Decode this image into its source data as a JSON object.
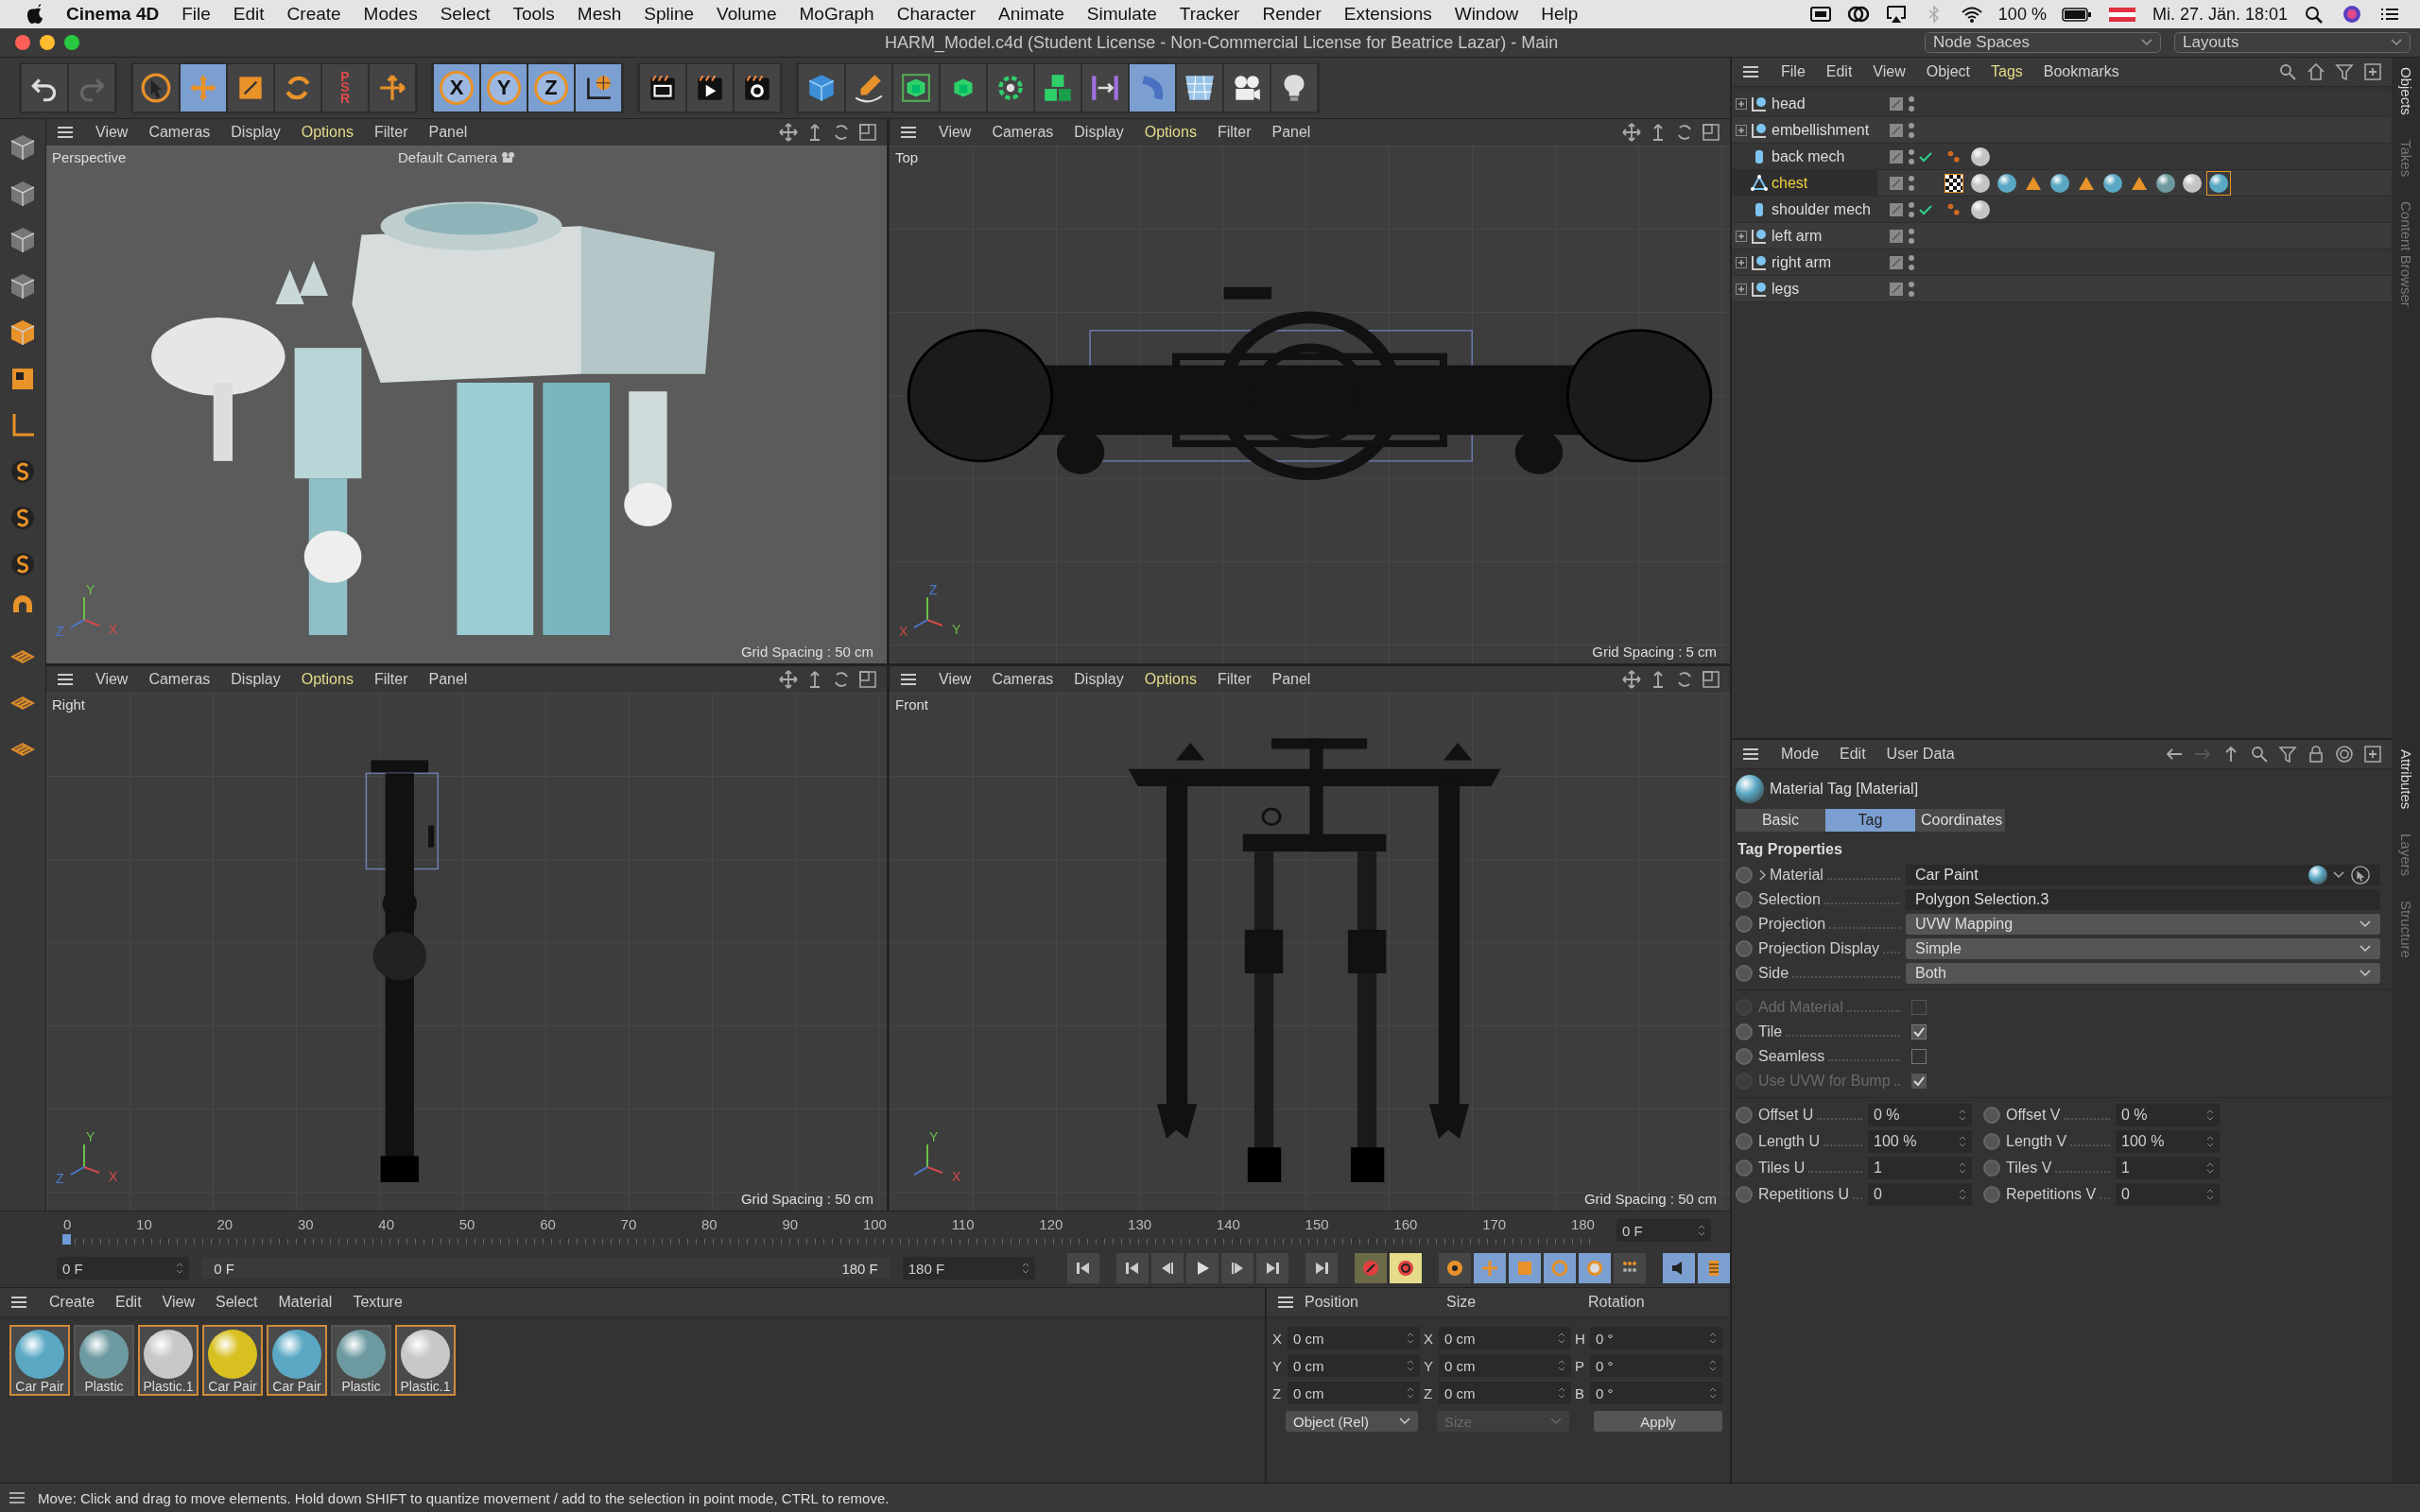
{
  "menubar": {
    "app": "Cinema 4D",
    "items": [
      "File",
      "Edit",
      "Create",
      "Modes",
      "Select",
      "Tools",
      "Mesh",
      "Spline",
      "Volume",
      "MoGraph",
      "Character",
      "Animate",
      "Simulate",
      "Tracker",
      "Render",
      "Extensions",
      "Window",
      "Help"
    ],
    "battery": "100 %",
    "clock": "Mi. 27. Jän. 18:01"
  },
  "window": {
    "title": "HARM_Model.c4d (Student License - Non-Commercial License for Beatrice Lazar) - Main",
    "dropdowns": [
      "Node Spaces",
      "Layouts"
    ]
  },
  "toolbar": [
    [
      {
        "kind": "undo",
        "selected": false
      },
      {
        "kind": "redo",
        "selected": false
      }
    ],
    [
      {
        "kind": "select",
        "selected": false
      },
      {
        "kind": "move",
        "selected": true
      },
      {
        "kind": "scale",
        "selected": false
      },
      {
        "kind": "rotate",
        "selected": false
      },
      {
        "kind": "psr",
        "label": "PSR",
        "selected": false
      },
      {
        "kind": "axis",
        "selected": false
      }
    ],
    [
      {
        "kind": "letter",
        "label": "X",
        "selected": true
      },
      {
        "kind": "letter",
        "label": "Y",
        "selected": true
      },
      {
        "kind": "letter",
        "label": "Z",
        "selected": true
      },
      {
        "kind": "world",
        "selected": true
      }
    ],
    [
      {
        "kind": "clapper",
        "selected": false
      },
      {
        "kind": "render",
        "selected": false
      },
      {
        "kind": "render-settings",
        "selected": false
      }
    ],
    [
      {
        "kind": "cube",
        "selected": false
      },
      {
        "kind": "pen",
        "selected": false
      },
      {
        "kind": "subdiv",
        "selected": false
      },
      {
        "kind": "extrude",
        "selected": false
      },
      {
        "kind": "cloner",
        "selected": false
      },
      {
        "kind": "cubes",
        "selected": false
      },
      {
        "kind": "symmetry",
        "selected": false
      },
      {
        "kind": "deformer",
        "selected": true
      },
      {
        "kind": "floor",
        "selected": false
      },
      {
        "kind": "camera",
        "selected": false
      },
      {
        "kind": "light",
        "selected": false
      }
    ]
  ],
  "viewports": [
    {
      "kind": "perspective",
      "name": "Perspective",
      "camera": "Default Camera",
      "grid": "Grid Spacing : 50 cm",
      "menu": [
        {
          "label": "View",
          "selected": false
        },
        {
          "label": "Cameras",
          "selected": false
        },
        {
          "label": "Display",
          "selected": false
        },
        {
          "label": "Options",
          "selected": true
        },
        {
          "label": "Filter",
          "selected": false
        },
        {
          "label": "Panel",
          "selected": false
        }
      ],
      "axes": [
        {
          "label": "Y",
          "color": "#6cc04a"
        },
        {
          "label": "X",
          "color": "#d04a4a"
        },
        {
          "label": "Z",
          "color": "#4a7ad0"
        }
      ]
    },
    {
      "kind": "top",
      "name": "Top",
      "grid": "Grid Spacing : 5 cm",
      "menu": [
        {
          "label": "View",
          "selected": false
        },
        {
          "label": "Cameras",
          "selected": false
        },
        {
          "label": "Display",
          "selected": false
        },
        {
          "label": "Options",
          "selected": true
        },
        {
          "label": "Filter",
          "selected": false
        },
        {
          "label": "Panel",
          "selected": false
        }
      ],
      "axes": [
        {
          "label": "Z",
          "color": "#4a7ad0"
        },
        {
          "label": "Y",
          "color": "#6cc04a"
        },
        {
          "label": "X",
          "color": "#d04a4a"
        }
      ]
    },
    {
      "kind": "right",
      "name": "Right",
      "grid": "Grid Spacing : 50 cm",
      "menu": [
        {
          "label": "View",
          "selected": false
        },
        {
          "label": "Cameras",
          "selected": false
        },
        {
          "label": "Display",
          "selected": false
        },
        {
          "label": "Options",
          "selected": true
        },
        {
          "label": "Filter",
          "selected": false
        },
        {
          "label": "Panel",
          "selected": false
        }
      ],
      "axes": [
        {
          "label": "Y",
          "color": "#6cc04a"
        },
        {
          "label": "X",
          "color": "#d04a4a"
        },
        {
          "label": "Z",
          "color": "#4a7ad0"
        }
      ]
    },
    {
      "kind": "front",
      "name": "Front",
      "grid": "Grid Spacing : 50 cm",
      "menu": [
        {
          "label": "View",
          "selected": false
        },
        {
          "label": "Cameras",
          "selected": false
        },
        {
          "label": "Display",
          "selected": false
        },
        {
          "label": "Options",
          "selected": true
        },
        {
          "label": "Filter",
          "selected": false
        },
        {
          "label": "Panel",
          "selected": false
        }
      ],
      "axes": [
        {
          "label": "Y",
          "color": "#6cc04a"
        },
        {
          "label": "X",
          "color": "#d04a4a"
        }
      ]
    }
  ],
  "objects": {
    "menu": [
      {
        "label": "File",
        "selected": false
      },
      {
        "label": "Edit",
        "selected": false
      },
      {
        "label": "View",
        "selected": false
      },
      {
        "label": "Object",
        "selected": false
      },
      {
        "label": "Tags",
        "selected": true
      },
      {
        "label": "Bookmarks",
        "selected": false
      }
    ],
    "side_tabs": [
      {
        "label": "Objects",
        "selected": true
      },
      {
        "label": "Takes",
        "selected": false
      },
      {
        "label": "Content Browser",
        "selected": false
      }
    ],
    "items": [
      {
        "name": "head",
        "kind": "group",
        "expanded": false,
        "selected": false,
        "checked": false
      },
      {
        "name": "embellishment",
        "kind": "group",
        "expanded": false,
        "selected": false,
        "checked": false
      },
      {
        "name": "back mech",
        "kind": "cylinder",
        "selected": false,
        "checked": true,
        "tags": [
          {
            "kind": "points",
            "selected": false
          },
          {
            "kind": "material",
            "color": "#c4c4c4",
            "selected": false
          }
        ]
      },
      {
        "name": "chest",
        "kind": "polygon",
        "selected": true,
        "checked": false,
        "tags": [
          {
            "kind": "checker",
            "selected": false
          },
          {
            "kind": "material",
            "color": "#c4c4c4",
            "selected": false
          },
          {
            "kind": "material",
            "color": "#5aa8c4",
            "selected": false
          },
          {
            "kind": "triangle",
            "selected": false
          },
          {
            "kind": "material",
            "color": "#5aa8c4",
            "selected": false
          },
          {
            "kind": "triangle",
            "selected": false
          },
          {
            "kind": "material",
            "color": "#5aa8c4",
            "selected": false
          },
          {
            "kind": "triangle",
            "selected": false
          },
          {
            "kind": "material",
            "color": "#6d9aa0",
            "selected": false
          },
          {
            "kind": "material",
            "color": "#c4c4c4",
            "selected": false
          },
          {
            "kind": "material",
            "color": "#5aa8c4",
            "selected": true
          }
        ]
      },
      {
        "name": "shoulder mech",
        "kind": "cylinder",
        "selected": false,
        "checked": true,
        "tags": [
          {
            "kind": "points",
            "selected": false
          },
          {
            "kind": "material",
            "color": "#c4c4c4",
            "selected": false
          }
        ]
      },
      {
        "name": "left arm",
        "kind": "group",
        "expanded": false,
        "selected": false,
        "checked": false
      },
      {
        "name": "right arm",
        "kind": "group",
        "expanded": false,
        "selected": false,
        "checked": false
      },
      {
        "name": "legs",
        "kind": "group",
        "expanded": false,
        "selected": false,
        "checked": false
      }
    ]
  },
  "attributes": {
    "menu": [
      "Mode",
      "Edit",
      "User Data"
    ],
    "side_tabs": [
      {
        "label": "Attributes",
        "selected": true
      },
      {
        "label": "Layers",
        "selected": false
      },
      {
        "label": "Structure",
        "selected": false
      }
    ],
    "title": "Material Tag [Material]",
    "tabs": [
      {
        "label": "Basic",
        "selected": false
      },
      {
        "label": "Tag",
        "selected": true
      },
      {
        "label": "Coordinates",
        "selected": false
      }
    ],
    "section": "Tag Properties",
    "props": [
      {
        "kind": "link",
        "label": "Material",
        "value": "Car Paint"
      },
      {
        "kind": "text",
        "label": "Selection",
        "value": "Polygon Selection.3"
      },
      {
        "kind": "dropdown",
        "label": "Projection",
        "value": "UVW Mapping"
      },
      {
        "kind": "dropdown",
        "label": "Projection Display",
        "value": "Simple"
      },
      {
        "kind": "dropdown",
        "label": "Side",
        "value": "Both"
      }
    ],
    "checks": [
      {
        "label": "Add Material",
        "checked": false,
        "disabled": true
      },
      {
        "label": "Tile",
        "checked": true,
        "disabled": false
      },
      {
        "label": "Seamless",
        "checked": false,
        "disabled": false
      },
      {
        "label": "Use UVW for Bump",
        "checked": true,
        "disabled": true
      }
    ],
    "pairs": [
      [
        {
          "label": "Offset U",
          "value": "0 %"
        },
        {
          "label": "Offset V",
          "value": "0 %"
        }
      ],
      [
        {
          "label": "Length U",
          "value": "100 %"
        },
        {
          "label": "Length V",
          "value": "100 %"
        }
      ],
      [
        {
          "label": "Tiles U",
          "value": "1"
        },
        {
          "label": "Tiles V",
          "value": "1"
        }
      ],
      [
        {
          "label": "Repetitions U",
          "value": "0"
        },
        {
          "label": "Repetitions V",
          "value": "0"
        }
      ]
    ]
  },
  "timeline": {
    "ticks": [
      "0",
      "10",
      "20",
      "30",
      "40",
      "50",
      "60",
      "70",
      "80",
      "90",
      "100",
      "110",
      "120",
      "130",
      "140",
      "150",
      "160",
      "170",
      "180"
    ],
    "current": "0 F",
    "start": "0 F",
    "range_start": "0 F",
    "range_end": "180 F",
    "end": "180 F",
    "level": 0
  },
  "materials": {
    "menu": [
      "Create",
      "Edit",
      "View",
      "Select",
      "Material",
      "Texture"
    ],
    "items": [
      {
        "name": "Car Pair",
        "color": "#5aa8c4",
        "selected": true
      },
      {
        "name": "Plastic",
        "color": "#6d9aa0",
        "selected": false
      },
      {
        "name": "Plastic.1",
        "color": "#c8c8c8",
        "selected": true
      },
      {
        "name": "Car Pair",
        "color": "#d8c020",
        "selected": true
      },
      {
        "name": "Car Pair",
        "color": "#5aa8c4",
        "selected": true
      },
      {
        "name": "Plastic",
        "color": "#6d9aa0",
        "selected": false
      },
      {
        "name": "Plastic.1",
        "color": "#c8c8c8",
        "selected": true
      }
    ]
  },
  "coordinates": {
    "columns": [
      "Position",
      "Size",
      "Rotation"
    ],
    "rows": [
      [
        {
          "axis": "X",
          "value": "0 cm"
        },
        {
          "axis": "X",
          "value": "0 cm"
        },
        {
          "axis": "H",
          "value": "0 °"
        }
      ],
      [
        {
          "axis": "Y",
          "value": "0 cm"
        },
        {
          "axis": "Y",
          "value": "0 cm"
        },
        {
          "axis": "P",
          "value": "0 °"
        }
      ],
      [
        {
          "axis": "Z",
          "value": "0 cm"
        },
        {
          "axis": "Z",
          "value": "0 cm"
        },
        {
          "axis": "B",
          "value": "0 °"
        }
      ]
    ],
    "mode": "Object (Rel)",
    "size_mode": {
      "label": "Size",
      "disabled": true
    },
    "apply": "Apply"
  },
  "status_bar": "Move: Click and drag to move elements. Hold down SHIFT to quantize movement / add to the selection in point mode, CTRL to remove."
}
